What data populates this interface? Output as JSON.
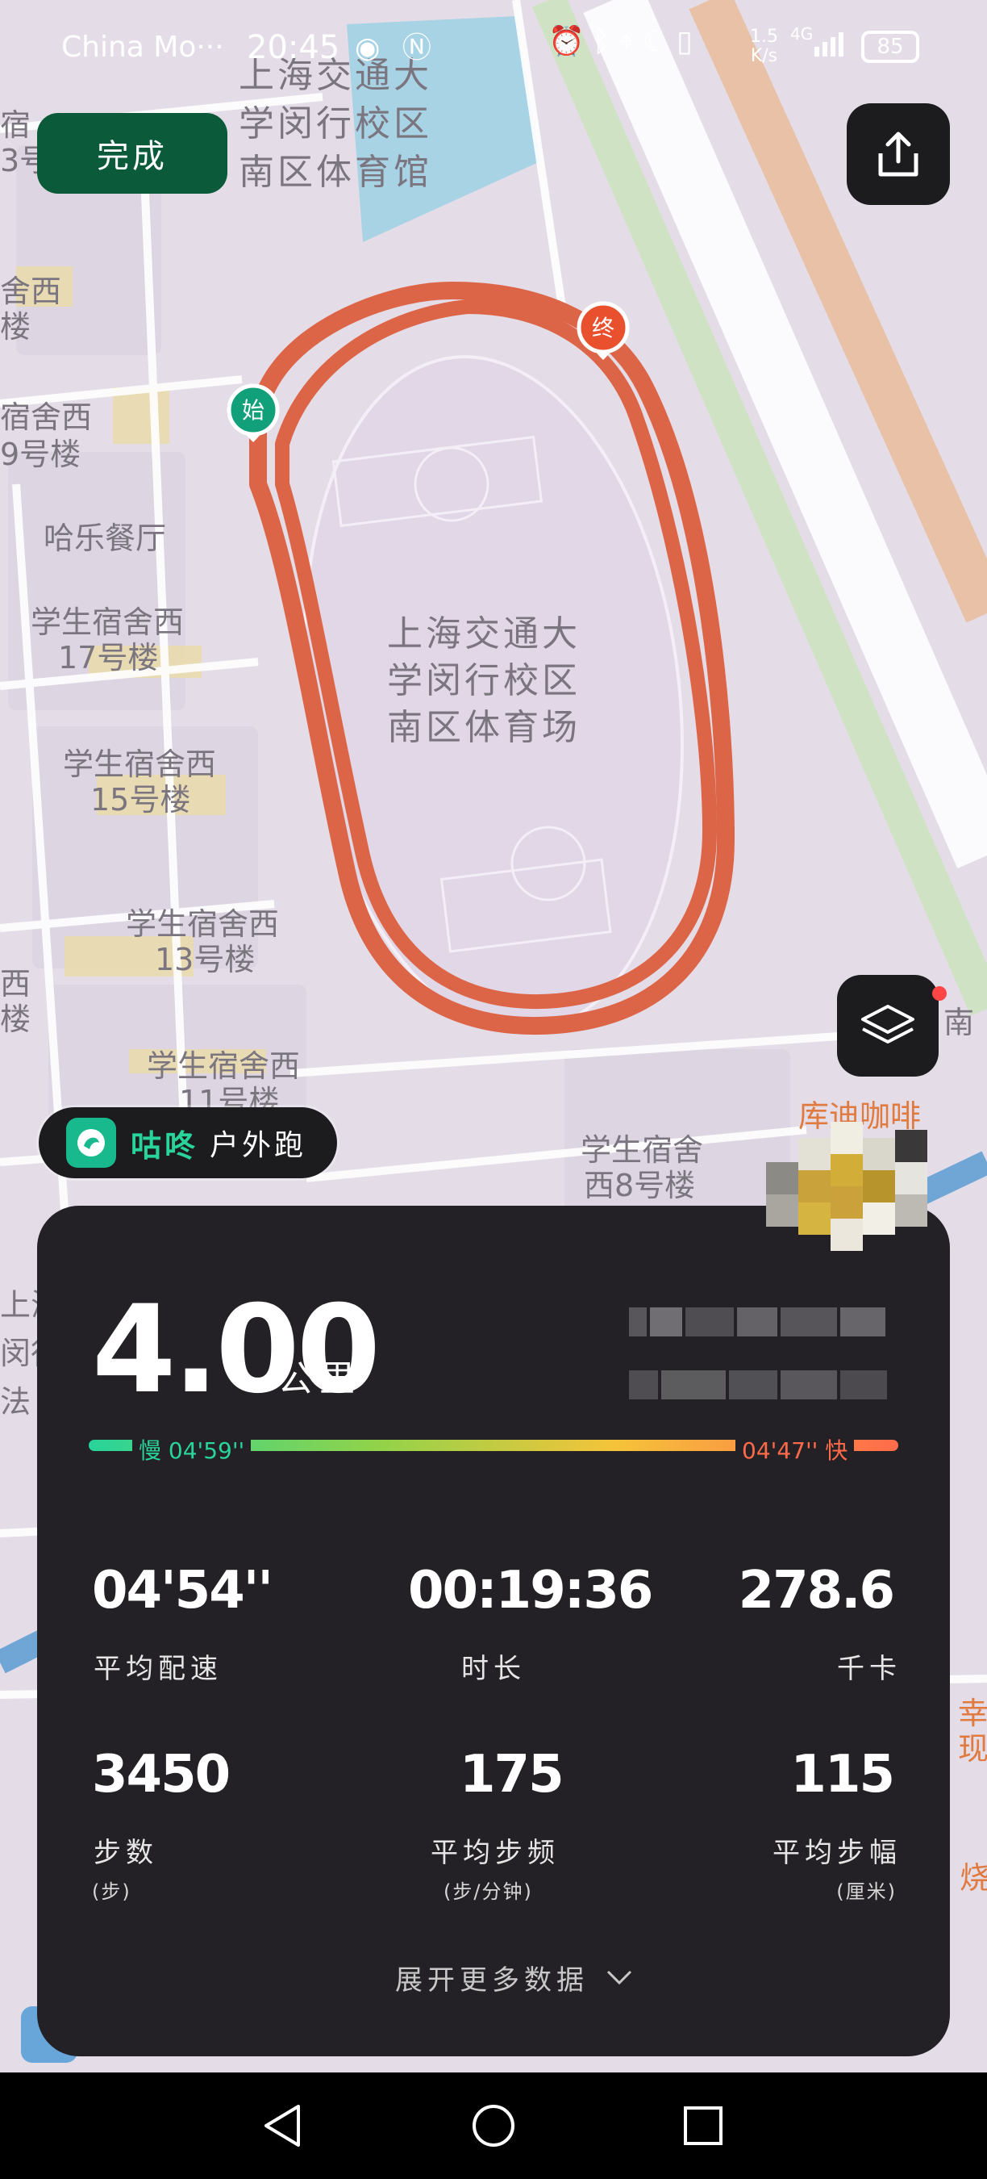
{
  "status_bar": {
    "carrier": "China Mo···",
    "time": "20:45",
    "speed_value": "1.5",
    "speed_unit": "K/s",
    "network": "4G",
    "battery": "85"
  },
  "header": {
    "done_label": "完成",
    "share_icon": "share-icon"
  },
  "map": {
    "start_marker": "始",
    "end_marker": "终",
    "labels": [
      "上海交通大",
      "学闵行校区",
      "南区体育馆",
      "上海交通大",
      "学闵行校区",
      "南区体育场",
      "哈乐餐厅",
      "舍西",
      "楼",
      "宿舍西",
      "9号楼",
      "学生宿舍西",
      "17号楼",
      "学生宿舍西",
      "15号楼",
      "学生宿舍西",
      "13号楼",
      "学生宿舍西",
      "11号楼",
      "学生宿舍",
      "西8号楼",
      "库迪咖啡",
      "宿",
      "3号",
      "西",
      "楼",
      "南",
      "上海",
      "闵行",
      "法",
      "幸",
      "现",
      "烧"
    ],
    "route_color": "#dd6547",
    "layer_icon": "layers-icon"
  },
  "app": {
    "name": "咕咚",
    "mode": "户外跑"
  },
  "summary": {
    "distance": "4.00",
    "distance_unit": "公里",
    "slow_label": "慢 04'59''",
    "fast_label": "04'47'' 快",
    "stats": [
      {
        "value": "04'54''",
        "label": "平均配速",
        "unit": ""
      },
      {
        "value": "00:19:36",
        "label": "时长",
        "unit": ""
      },
      {
        "value": "278.6",
        "label": "千卡",
        "unit": ""
      },
      {
        "value": "3450",
        "label": "步数",
        "unit": "(步)"
      },
      {
        "value": "175",
        "label": "平均步频",
        "unit": "(步/分钟)"
      },
      {
        "value": "115",
        "label": "平均步幅",
        "unit": "(厘米)"
      }
    ],
    "expand_label": "展开更多数据"
  },
  "colors": {
    "accent_green": "#28d49a",
    "accent_orange": "#ff6b4a",
    "card_bg": "#232125",
    "done_bg": "#0b5b3b"
  }
}
